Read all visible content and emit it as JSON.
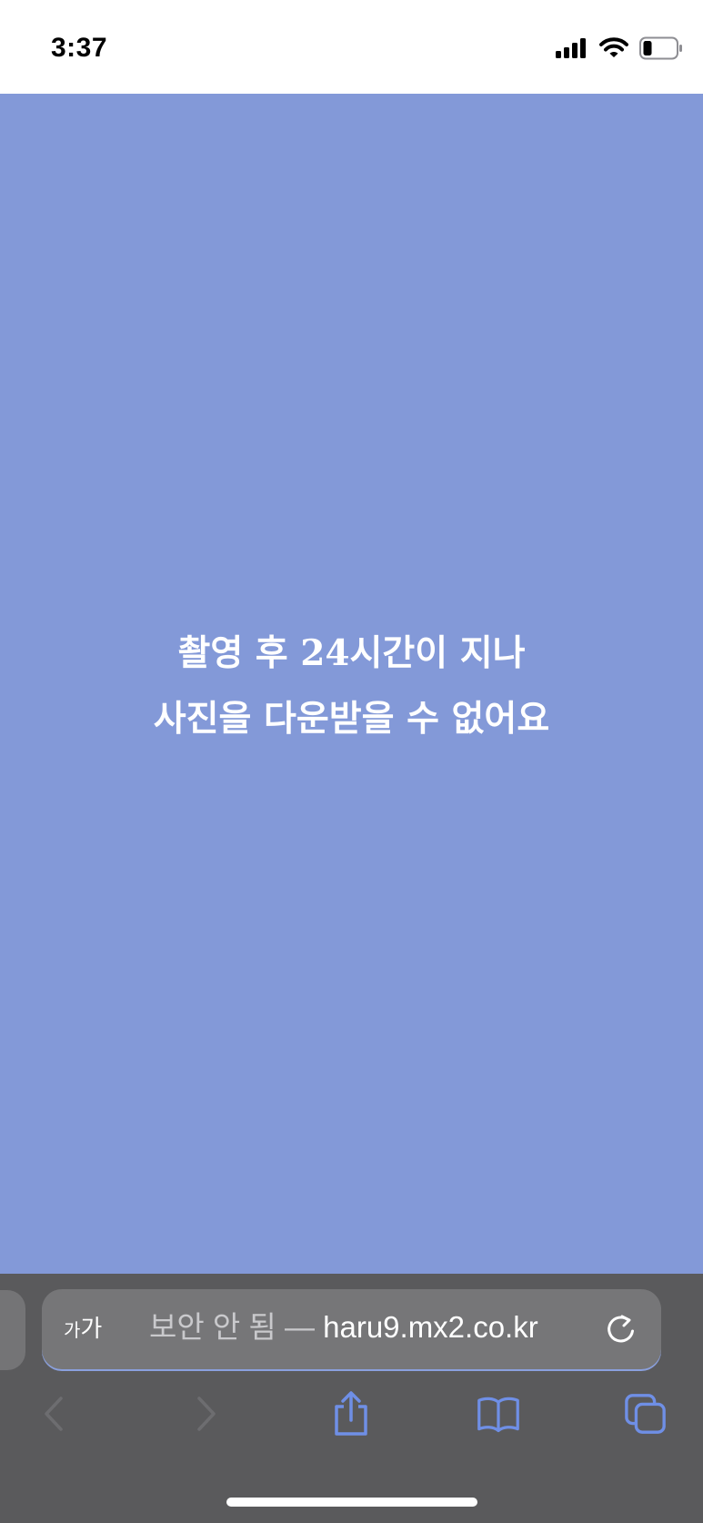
{
  "status_bar": {
    "time": "3:37",
    "icons": [
      "cellular-signal-icon",
      "wifi-icon",
      "battery-icon"
    ]
  },
  "page": {
    "background_color": "#8399d8",
    "message_line1": "촬영 후 24시간이 지나",
    "message_line2": "사진을 다운받을 수 없어요"
  },
  "browser": {
    "text_size_label_small": "가",
    "text_size_label_large": "가",
    "security_label": "보안 안 됨 —",
    "domain": "haru9.mx2.co.kr",
    "accent_color": "#6f8fe6",
    "toolbar": {
      "back": "back-icon",
      "forward": "forward-icon",
      "share": "share-icon",
      "bookmarks": "bookmarks-icon",
      "tabs": "tabs-icon"
    }
  }
}
